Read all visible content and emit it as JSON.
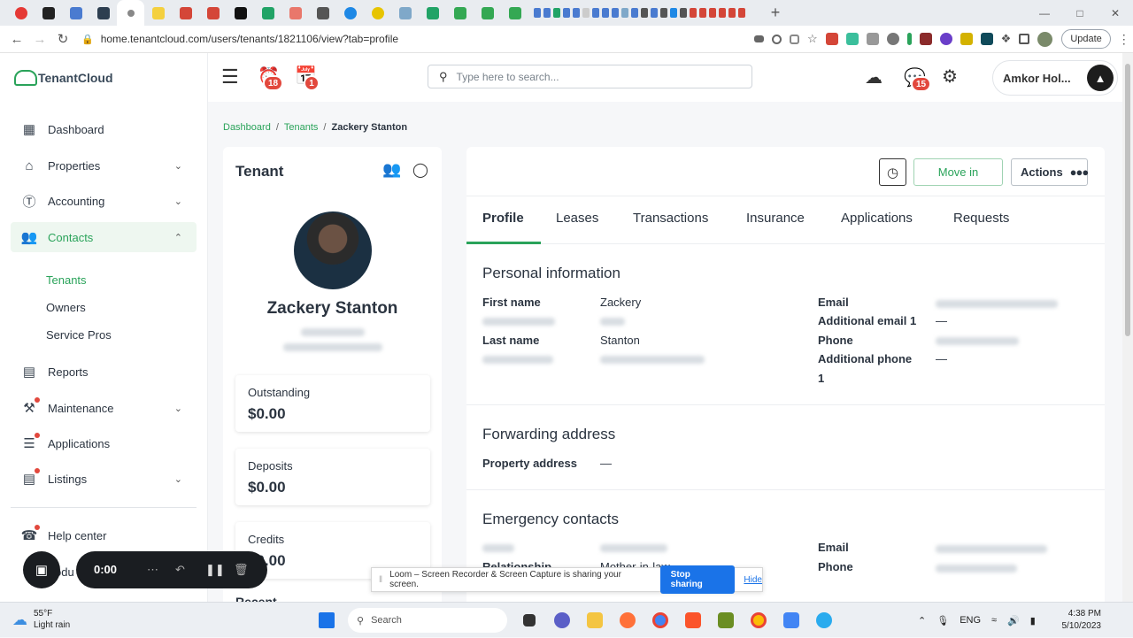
{
  "browser": {
    "url": "home.tenantcloud.com/users/tenants/1821106/view?tab=profile",
    "update_label": "Update",
    "new_tab_symbol": "+"
  },
  "app": {
    "logo_text": "TenantCloud",
    "search_placeholder": "Type here to search...",
    "alarm_badge": "18",
    "calendar_badge": "1",
    "chat_badge": "15",
    "user_name": "Amkor Hol...",
    "accent_color": "#2aa35a"
  },
  "sidebar": {
    "items": [
      {
        "label": "Dashboard",
        "icon": "dashboard-icon"
      },
      {
        "label": "Properties",
        "icon": "home-icon"
      },
      {
        "label": "Accounting",
        "icon": "dollar-icon"
      },
      {
        "label": "Contacts",
        "icon": "contacts-icon"
      },
      {
        "label": "Reports",
        "icon": "reports-icon"
      },
      {
        "label": "Maintenance",
        "icon": "hammer-icon"
      },
      {
        "label": "Applications",
        "icon": "applications-icon"
      },
      {
        "label": "Listings",
        "icon": "listings-icon"
      },
      {
        "label": "Help center",
        "icon": "headset-icon"
      }
    ],
    "sub_items": [
      "Tenants",
      "Owners",
      "Service Pros"
    ],
    "partial_label": "odu"
  },
  "breadcrumb": {
    "items": [
      "Dashboard",
      "Tenants",
      "Zackery Stanton"
    ],
    "separator": "/"
  },
  "tenant_card": {
    "title": "Tenant",
    "name": "Zackery Stanton",
    "stats": [
      {
        "label": "Outstanding",
        "value": "$0.00"
      },
      {
        "label": "Deposits",
        "value": "$0.00"
      },
      {
        "label": "Credits",
        "value": "$0.00"
      }
    ],
    "partial_section": "Recent"
  },
  "profile": {
    "move_in_label": "Move in",
    "actions_label": "Actions",
    "tabs": [
      "Profile",
      "Leases",
      "Transactions",
      "Insurance",
      "Applications",
      "Requests"
    ],
    "personal_title": "Personal information",
    "first_name_label": "First name",
    "first_name": "Zackery",
    "last_name_label": "Last name",
    "last_name": "Stanton",
    "email_label": "Email",
    "additional_email_label": "Additional email 1",
    "additional_email": "—",
    "phone_label": "Phone",
    "additional_phone_label": "Additional phone",
    "additional_phone_suffix": "1",
    "additional_phone": "—",
    "forwarding_title": "Forwarding address",
    "property_address_label": "Property address",
    "property_address": "—",
    "emergency_title": "Emergency contacts",
    "emergency_email_label": "Email",
    "emergency_phone_label": "Phone",
    "relationship_partial": "Relationship",
    "relationship_value_partial": "Mother-in-law"
  },
  "loom": {
    "time": "0:00",
    "share_text": "Loom – Screen Recorder & Screen Capture is sharing your screen.",
    "stop_label": "Stop sharing",
    "hide_label": "Hide"
  },
  "taskbar": {
    "temp": "55°F",
    "weather": "Light rain",
    "search_label": "Search",
    "lang": "ENG",
    "time": "4:38 PM",
    "date": "5/10/2023"
  }
}
